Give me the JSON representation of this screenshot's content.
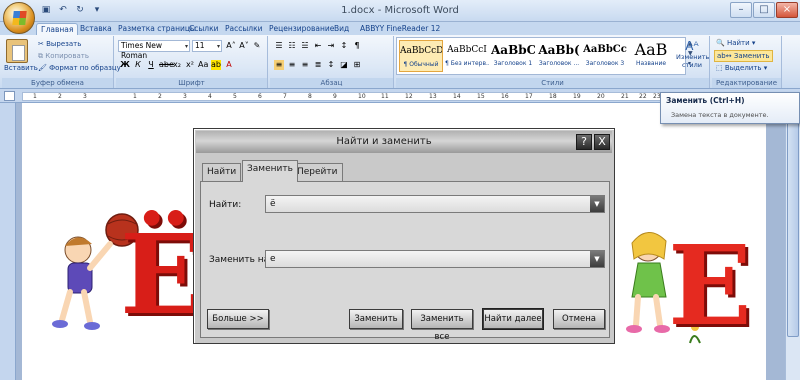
{
  "window": {
    "title": "1.docx - Microsoft Word"
  },
  "tabs": [
    "Главная",
    "Вставка",
    "Разметка страницы",
    "Ссылки",
    "Рассылки",
    "Рецензирование",
    "Вид",
    "ABBYY FineReader 12"
  ],
  "ribbon": {
    "clipboard": {
      "paste": "Вставить",
      "cut": "Вырезать",
      "copy": "Копировать",
      "format_painter": "Формат по образцу",
      "label": "Буфер обмена"
    },
    "font": {
      "name": "Times New Roman",
      "size": "11",
      "label": "Шрифт"
    },
    "paragraph": {
      "label": "Абзац"
    },
    "styles": {
      "items": [
        {
          "preview": "AaBbCcDd",
          "name": "¶ Обычный"
        },
        {
          "preview": "AaBbCcI",
          "name": "¶ Без интерв..."
        },
        {
          "preview": "AaBbC",
          "name": "Заголовок 1"
        },
        {
          "preview": "AaBb(",
          "name": "Заголовок ..."
        },
        {
          "preview": "AaBbCc",
          "name": "Заголовок 3"
        },
        {
          "preview": "AaB",
          "name": "Название"
        }
      ],
      "change": "Изменить стили",
      "label": "Стили"
    },
    "editing": {
      "find": "Найти",
      "replace": "Заменить",
      "select": "Выделить",
      "label": "Редактирование"
    }
  },
  "tooltip": {
    "title": "Заменить (Ctrl+H)",
    "text": "Замена текста в документе."
  },
  "ruler": {
    "ticks": [
      "1",
      "2",
      "3",
      "1",
      "2",
      "3",
      "4",
      "5",
      "6",
      "7",
      "8",
      "9",
      "10",
      "11",
      "12",
      "13",
      "14",
      "15",
      "16",
      "17",
      "18",
      "19",
      "20",
      "21",
      "22",
      "23"
    ]
  },
  "clipart": {
    "left_letter": "Ё",
    "right_letter": "Е"
  },
  "dialog": {
    "title": "Найти и заменить",
    "help": "?",
    "close": "X",
    "tabs": [
      "Найти",
      "Заменить",
      "Перейти"
    ],
    "find_label": "Найти:",
    "find_value": "ё",
    "replace_label": "Заменить на:",
    "replace_value": "е",
    "buttons": {
      "more": "Больше >>",
      "replace": "Заменить",
      "replace_all": "Заменить все",
      "find_next": "Найти далее",
      "cancel": "Отмена"
    }
  }
}
